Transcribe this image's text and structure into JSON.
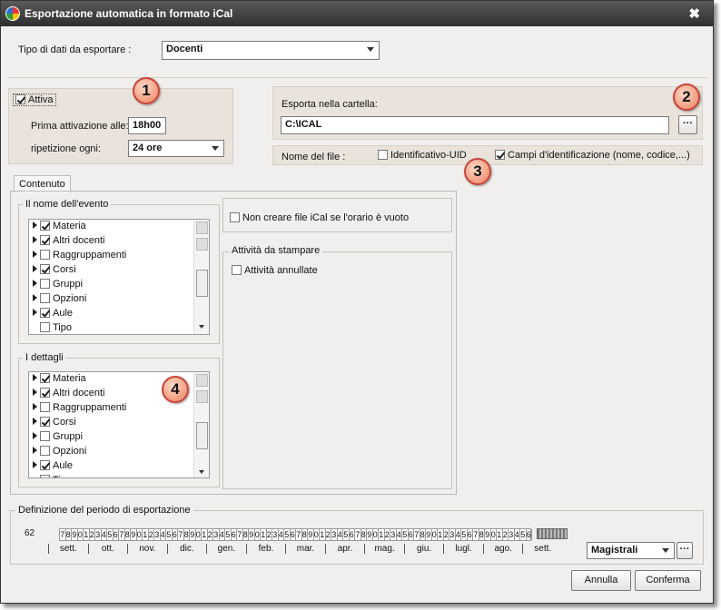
{
  "window": {
    "title": "Esportazione automatica in formato iCal",
    "close_glyph": "✖"
  },
  "tipo": {
    "label": "Tipo di dati da esportare :",
    "value": "Docenti"
  },
  "attivazione": {
    "attiva_label": "Attiva",
    "attiva_checked": true,
    "prima_label": "Prima attivazione alle:",
    "prima_value": "18h00",
    "ripetizione_label": "ripetizione ogni:",
    "ripetizione_value": "24 ore"
  },
  "export": {
    "folder_label": "Esporta nella cartella:",
    "folder_value": "C:\\ICAL",
    "browse_label": "···"
  },
  "filename": {
    "label": "Nome del file :",
    "uid_label": "Identificativo-UID",
    "uid_checked": false,
    "campi_label": "Campi d'identificazione (nome, codice,...)",
    "campi_checked": true
  },
  "badges": [
    "1",
    "2",
    "3",
    "4"
  ],
  "content_tab": "Contenuto",
  "event_name_group": {
    "title": "Il nome dell'evento",
    "items": [
      {
        "label": "Materia",
        "checked": true,
        "expand": true
      },
      {
        "label": "Altri docenti",
        "checked": true,
        "expand": true
      },
      {
        "label": "Raggruppamenti",
        "checked": false,
        "expand": true
      },
      {
        "label": "Corsi",
        "checked": true,
        "expand": true
      },
      {
        "label": "Gruppi",
        "checked": false,
        "expand": true
      },
      {
        "label": "Opzioni",
        "checked": false,
        "expand": true
      },
      {
        "label": "Aule",
        "checked": true,
        "expand": true
      },
      {
        "label": "Tipo",
        "checked": false,
        "expand": false
      }
    ]
  },
  "details_group": {
    "title": "I dettagli",
    "items": [
      {
        "label": "Materia",
        "checked": true,
        "expand": true
      },
      {
        "label": "Altri docenti",
        "checked": true,
        "expand": true
      },
      {
        "label": "Raggruppamenti",
        "checked": false,
        "expand": true
      },
      {
        "label": "Corsi",
        "checked": true,
        "expand": true
      },
      {
        "label": "Gruppi",
        "checked": false,
        "expand": true
      },
      {
        "label": "Opzioni",
        "checked": false,
        "expand": true
      },
      {
        "label": "Aule",
        "checked": true,
        "expand": true
      },
      {
        "label": "Ti",
        "checked": false,
        "expand": false
      }
    ]
  },
  "no_empty": {
    "label": "Non creare file iCal se l'orario è vuoto",
    "checked": false
  },
  "attivita": {
    "title": "Attività da stampare",
    "annullate_label": "Attività annullate",
    "annullate_checked": false
  },
  "periodo": {
    "title": "Definizione del periodo di esportazione",
    "count": "62",
    "weeks": [
      "7",
      "8",
      "9",
      "0",
      "1",
      "2",
      "3",
      "4",
      "5",
      "6",
      "7",
      "8",
      "9",
      "0",
      "1",
      "2",
      "3",
      "4",
      "5",
      "6",
      "7",
      "8",
      "9",
      "0",
      "1",
      "2",
      "3",
      "4",
      "5",
      "6",
      "7",
      "8",
      "9",
      "0",
      "1",
      "2",
      "3",
      "4",
      "5",
      "6",
      "7",
      "8",
      "9",
      "0",
      "1",
      "2",
      "3",
      "4",
      "5",
      "6",
      "7",
      "8",
      "9",
      "0",
      "1",
      "2",
      "3",
      "4",
      "5",
      "6",
      "7",
      "8",
      "9",
      "0",
      "1",
      "2",
      "3",
      "4",
      "5",
      "6",
      "7",
      "8",
      "9",
      "0",
      "1",
      "2",
      "3",
      "4",
      "5",
      "6"
    ],
    "months": [
      "sett.",
      "ott.",
      "nov.",
      "dic.",
      "gen.",
      "feb.",
      "mar.",
      "apr.",
      "mag.",
      "giu.",
      "lugl.",
      "ago.",
      "sett."
    ],
    "preset_value": "Magistrali",
    "preset_more": "···"
  },
  "buttons": {
    "annulla": "Annulla",
    "conferma": "Conferma"
  }
}
